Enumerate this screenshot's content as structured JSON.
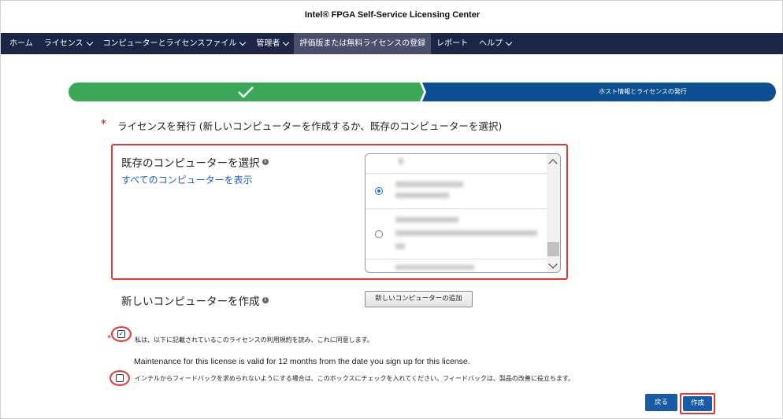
{
  "header": {
    "title": "Intel® FPGA Self-Service Licensing Center"
  },
  "nav": {
    "items": [
      {
        "label": "ホーム",
        "dropdown": false,
        "active": false
      },
      {
        "label": "ライセンス",
        "dropdown": true,
        "active": false
      },
      {
        "label": "コンピューターとライセンスファイル",
        "dropdown": true,
        "active": false
      },
      {
        "label": "管理者",
        "dropdown": true,
        "active": false
      },
      {
        "label": "評価版または無料ライセンスの登録",
        "dropdown": false,
        "active": true
      },
      {
        "label": "レポート",
        "dropdown": false,
        "active": false
      },
      {
        "label": "ヘルプ",
        "dropdown": true,
        "active": false
      }
    ]
  },
  "progress": {
    "step1_color": "#3aa857",
    "step2_color": "#0c4f93",
    "step2_label": "ホスト情報とライセンスの発行"
  },
  "form": {
    "issue_label": "ライセンスを発行 (新しいコンピューターを作成するか、既存のコンピューターを選択)",
    "existing_label": "既存のコンピューターを選択",
    "show_all_link": "すべてのコンピューターを表示",
    "new_computer_label": "新しいコンピューターを作成",
    "add_button": "新しいコンピューターの追加",
    "agree_text": "私は、以下に記載されているこのライセンスの利用規約を読み、これに同意します。",
    "agree_checked": true,
    "maintenance_text": "Maintenance for this license is valid for 12 months from the date you sign up for this license.",
    "feedback_text": "インテルからフィードバックを求められないようにする場合は、このボックスにチェックを入れてください。フィードバックは、製品の改善に役立ちます。",
    "feedback_checked": false,
    "back_button": "戻る",
    "create_button": "作成"
  },
  "colors": {
    "nav_bg": "#1d2546",
    "highlight": "#e53935",
    "button": "#1a5ba6"
  }
}
